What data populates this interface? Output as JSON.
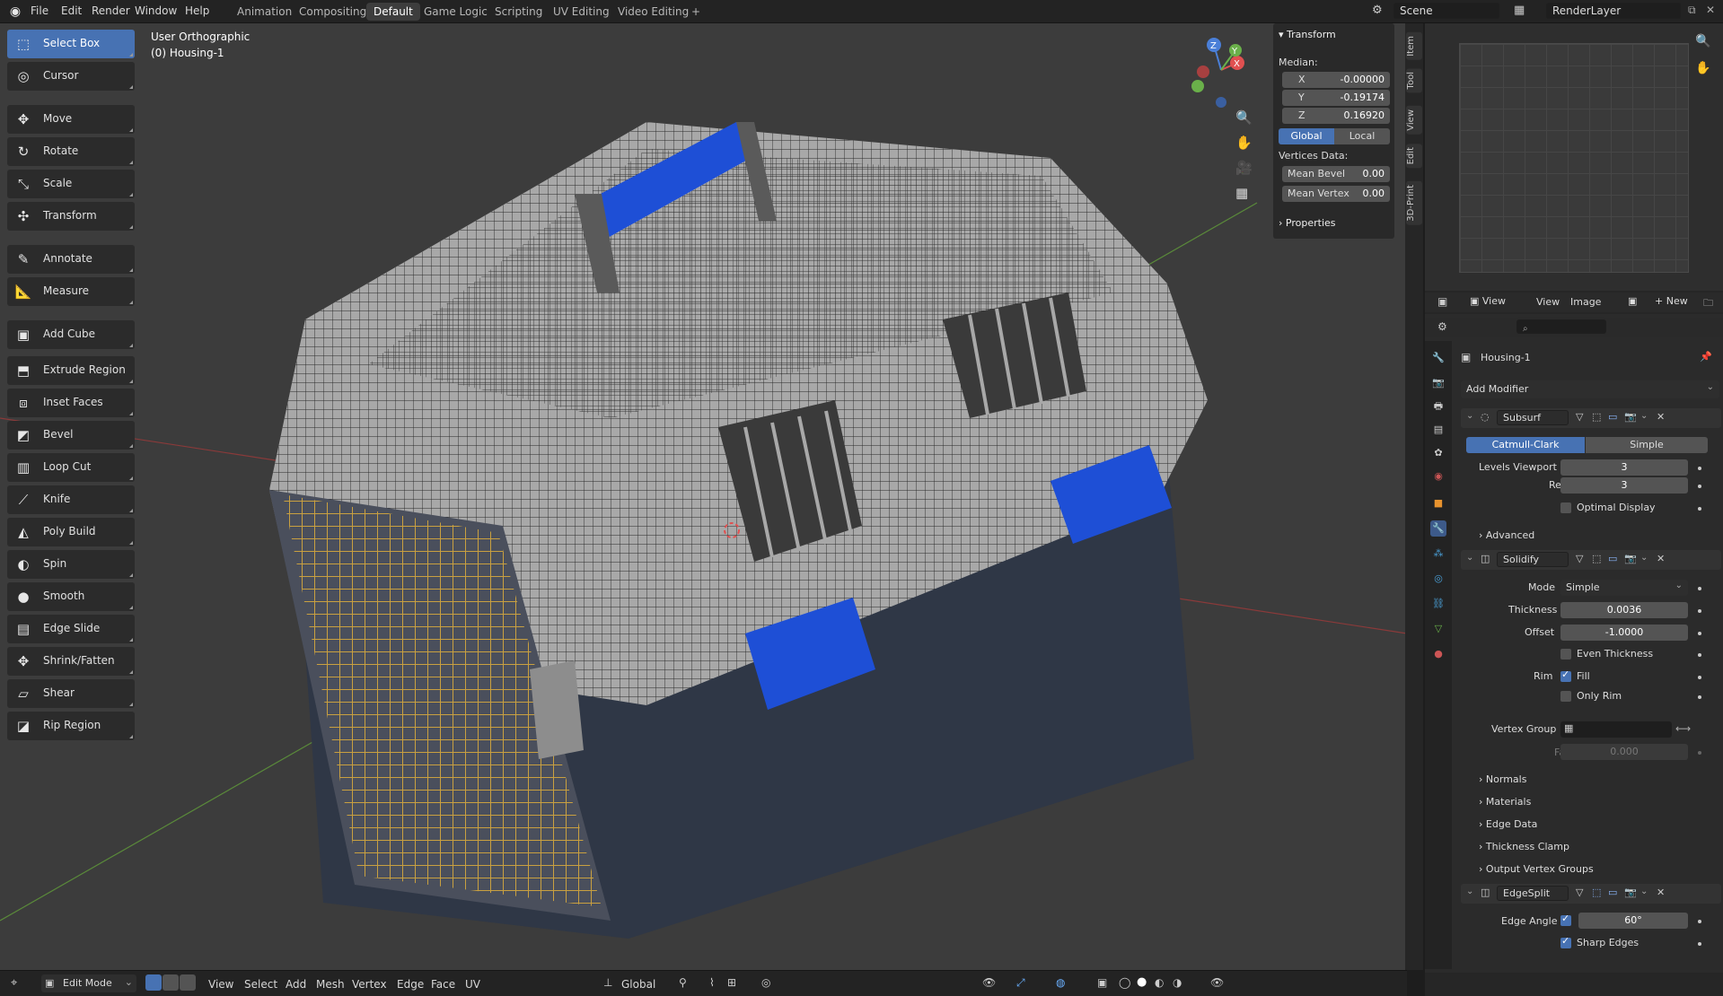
{
  "topbar": {
    "menus": [
      "File",
      "Edit",
      "Render",
      "Window",
      "Help"
    ],
    "workspaces": [
      "Animation",
      "Compositing",
      "Default",
      "Game Logic",
      "Scripting",
      "UV Editing",
      "Video Editing"
    ],
    "active_workspace": "Default",
    "add_workspace": "+",
    "scene": "Scene",
    "render_layer": "RenderLayer"
  },
  "viewport": {
    "view_name": "User Orthographic",
    "object_name": "(0) Housing-1"
  },
  "tools": [
    {
      "label": "Select Box",
      "icon": "select-box-icon",
      "glyph": "⬚",
      "active": true
    },
    {
      "label": "Cursor",
      "icon": "cursor-icon",
      "glyph": "◎"
    },
    {
      "label": "Move",
      "icon": "move-icon",
      "glyph": "✥"
    },
    {
      "label": "Rotate",
      "icon": "rotate-icon",
      "glyph": "↻"
    },
    {
      "label": "Scale",
      "icon": "scale-icon",
      "glyph": "⤡"
    },
    {
      "label": "Transform",
      "icon": "transform-icon",
      "glyph": "✣"
    },
    {
      "label": "Annotate",
      "icon": "annotate-icon",
      "glyph": "✎"
    },
    {
      "label": "Measure",
      "icon": "measure-icon",
      "glyph": "📐"
    },
    {
      "label": "Add Cube",
      "icon": "add-cube-icon",
      "glyph": "▣"
    },
    {
      "label": "Extrude Region",
      "icon": "extrude-icon",
      "glyph": "⬒"
    },
    {
      "label": "Inset Faces",
      "icon": "inset-icon",
      "glyph": "⧈"
    },
    {
      "label": "Bevel",
      "icon": "bevel-icon",
      "glyph": "◩"
    },
    {
      "label": "Loop Cut",
      "icon": "loop-cut-icon",
      "glyph": "▥"
    },
    {
      "label": "Knife",
      "icon": "knife-icon",
      "glyph": "⟋"
    },
    {
      "label": "Poly Build",
      "icon": "poly-build-icon",
      "glyph": "◭"
    },
    {
      "label": "Spin",
      "icon": "spin-icon",
      "glyph": "◐"
    },
    {
      "label": "Smooth",
      "icon": "smooth-icon",
      "glyph": "●"
    },
    {
      "label": "Edge Slide",
      "icon": "edge-slide-icon",
      "glyph": "▤"
    },
    {
      "label": "Shrink/Fatten",
      "icon": "shrink-fatten-icon",
      "glyph": "✥"
    },
    {
      "label": "Shear",
      "icon": "shear-icon",
      "glyph": "▱"
    },
    {
      "label": "Rip Region",
      "icon": "rip-region-icon",
      "glyph": "◪"
    }
  ],
  "npanel": {
    "section": "Transform",
    "median_label": "Median:",
    "x_label": "X",
    "x": "-0.00000",
    "y_label": "Y",
    "y": "-0.19174",
    "z_label": "Z",
    "z": "0.16920",
    "global": "Global",
    "local": "Local",
    "vertices_label": "Vertices Data:",
    "mean_bevel_label": "Mean Bevel",
    "mean_bevel": "0.00",
    "mean_vertex_label": "Mean Vertex",
    "mean_vertex": "0.00",
    "properties": "Properties"
  },
  "vtabs": [
    "Item",
    "Tool",
    "View",
    "Edit",
    "3D-Print"
  ],
  "image_editor": {
    "view": "View",
    "view2": "View",
    "image": "Image",
    "new": "New"
  },
  "properties": {
    "object": "Housing-1",
    "add_modifier": "Add Modifier",
    "subsurf": {
      "name": "Subsurf",
      "catmull": "Catmull-Clark",
      "simple": "Simple",
      "levels_label": "Levels Viewport",
      "levels": "3",
      "render_label": "Render",
      "render": "3",
      "optimal": "Optimal Display",
      "advanced": "Advanced"
    },
    "solidify": {
      "name": "Solidify",
      "mode_label": "Mode",
      "mode": "Simple",
      "thickness_label": "Thickness",
      "thickness": "0.0036",
      "offset_label": "Offset",
      "offset": "-1.0000",
      "even": "Even Thickness",
      "rim_label": "Rim",
      "fill": "Fill",
      "only_rim": "Only Rim",
      "vgroup_label": "Vertex Group",
      "factor_label": "Factor",
      "factor": "0.000",
      "sections": [
        "Normals",
        "Materials",
        "Edge Data",
        "Thickness Clamp",
        "Output Vertex Groups"
      ]
    },
    "edgesplit": {
      "name": "EdgeSplit",
      "angle_label": "Edge Angle",
      "angle": "60°",
      "sharp": "Sharp Edges"
    }
  },
  "bottombar": {
    "mode": "Edit Mode",
    "menus": [
      "View",
      "Select",
      "Add",
      "Mesh",
      "Vertex",
      "Edge",
      "Face",
      "UV"
    ],
    "orientation": "Global"
  },
  "colors": {
    "accent": "#4772b3",
    "carrier_grey": "#9a9a9a",
    "carrier_blue": "#1e4fd6",
    "door_gold": "#c9a040"
  }
}
